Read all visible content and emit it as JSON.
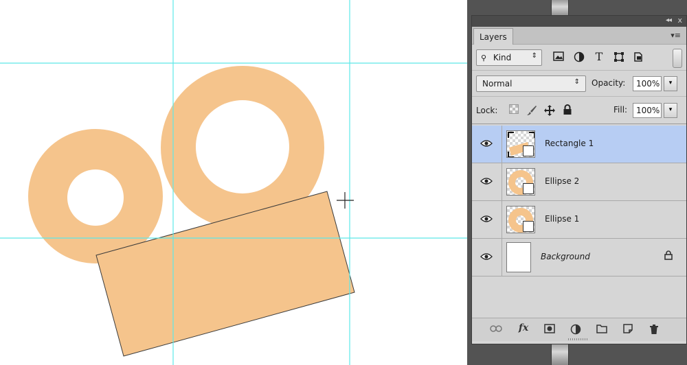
{
  "canvas": {
    "shape_color": "#f5c48c",
    "guide_color": "#5ce8e8"
  },
  "layers_panel": {
    "tab_label": "Layers",
    "collapse_glyph": "◂◂",
    "close_glyph": "x",
    "menu_glyph": "▾≡",
    "filter": {
      "kind_label": "Kind",
      "icons": [
        "image-filter-icon",
        "adjustment-filter-icon",
        "type-filter-icon",
        "shape-filter-icon",
        "smart-object-filter-icon"
      ]
    },
    "blend": {
      "mode": "Normal",
      "opacity_label": "Opacity:",
      "opacity_value": "100%"
    },
    "lock": {
      "label": "Lock:",
      "fill_label": "Fill:",
      "fill_value": "100%"
    },
    "layers": [
      {
        "name": "Rectangle 1",
        "selected": true
      },
      {
        "name": "Ellipse 2",
        "selected": false
      },
      {
        "name": "Ellipse 1",
        "selected": false
      },
      {
        "name": "Background",
        "selected": false,
        "locked": true
      }
    ],
    "footer_icons": [
      "link-icon",
      "fx-icon",
      "mask-icon",
      "adjustment-icon",
      "folder-icon",
      "new-layer-icon",
      "trash-icon"
    ],
    "type_glyph": "T",
    "fx_glyph": "fx"
  }
}
